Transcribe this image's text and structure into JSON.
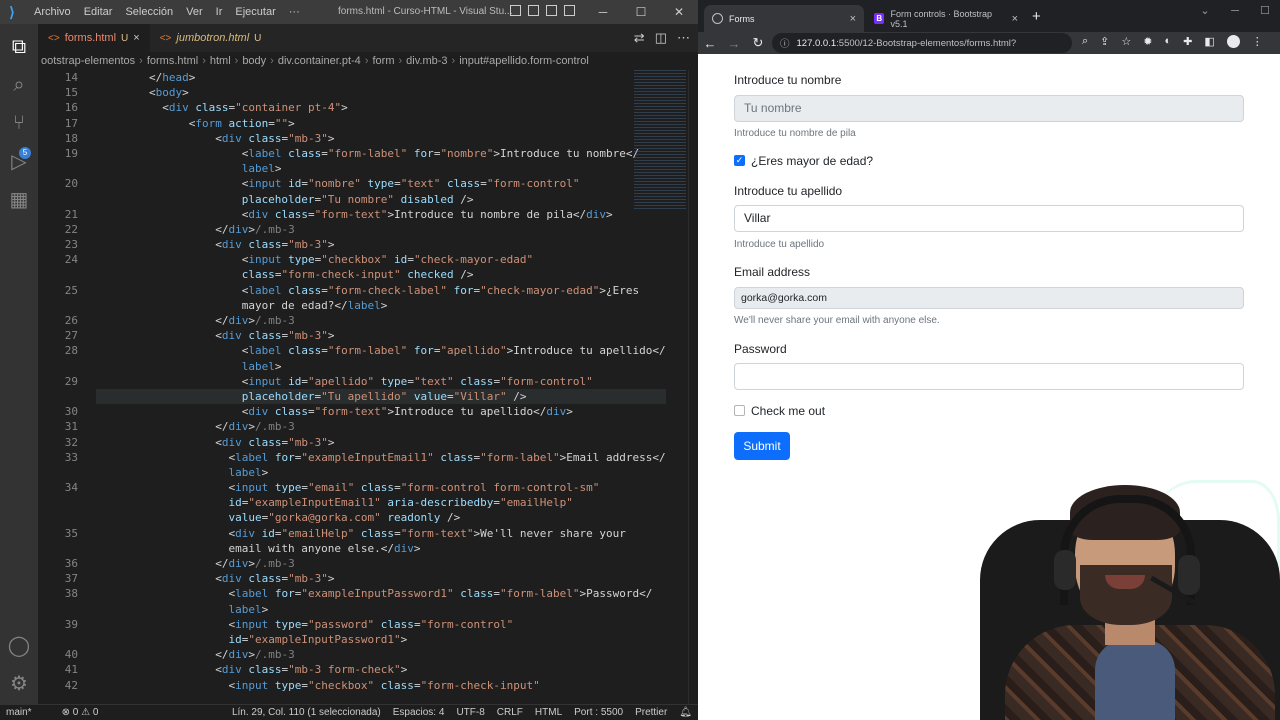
{
  "vscode": {
    "menu": [
      "Archivo",
      "Editar",
      "Selección",
      "Ver",
      "Ir",
      "Ejecutar",
      "···"
    ],
    "window_title": "forms.html - Curso-HTML - Visual Stu...",
    "tabs": [
      {
        "label": "forms.html",
        "status": "U",
        "close": "×"
      },
      {
        "label": "jumbotron.html",
        "status": "U"
      }
    ],
    "breadcrumb": [
      "ootstrap-elementos",
      "forms.html",
      "html",
      "body",
      "div.container.pt-4",
      "form",
      "div.mb-3",
      "input#apellido.form-control"
    ],
    "line_numbers": [
      "14",
      "15",
      "16",
      "17",
      "18",
      "19",
      "",
      "20",
      "",
      "21",
      "22",
      "23",
      "24",
      "",
      "25",
      "",
      "26",
      "27",
      "28",
      "",
      "29",
      "",
      "30",
      "31",
      "32",
      "33",
      "",
      "34",
      "",
      "",
      "35",
      "",
      "36",
      "37",
      "38",
      "",
      "39",
      "",
      "40",
      "41",
      "42"
    ],
    "code_lines": [
      [
        [
          "tx",
          "        </"
        ],
        [
          "tg",
          "head"
        ],
        [
          "tx",
          ">"
        ]
      ],
      [
        [
          "tx",
          "        <"
        ],
        [
          "tg",
          "body"
        ],
        [
          "tx",
          ">"
        ]
      ],
      [
        [
          "tx",
          "          <"
        ],
        [
          "tg",
          "div"
        ],
        [
          "at",
          " class"
        ],
        [
          "tx",
          "="
        ],
        [
          "vl",
          "\"container pt-4\""
        ],
        [
          "tx",
          ">"
        ]
      ],
      [
        [
          "tx",
          "              <"
        ],
        [
          "tg",
          "form"
        ],
        [
          "at",
          " action"
        ],
        [
          "tx",
          "="
        ],
        [
          "vl",
          "\"\""
        ],
        [
          "tx",
          ">"
        ]
      ],
      [
        [
          "tx",
          "                  <"
        ],
        [
          "tg",
          "div"
        ],
        [
          "at",
          " class"
        ],
        [
          "tx",
          "="
        ],
        [
          "vl",
          "\"mb-3\""
        ],
        [
          "tx",
          ">"
        ]
      ],
      [
        [
          "tx",
          "                      <"
        ],
        [
          "tg",
          "label"
        ],
        [
          "at",
          " class"
        ],
        [
          "tx",
          "="
        ],
        [
          "vl",
          "\"form-label\""
        ],
        [
          "at",
          " for"
        ],
        [
          "tx",
          "="
        ],
        [
          "vl",
          "\"nombre\""
        ],
        [
          "tx",
          ">Introduce tu nombre</"
        ]
      ],
      [
        [
          "tx",
          "                      "
        ],
        [
          "tg",
          "label"
        ],
        [
          "tx",
          ">"
        ]
      ],
      [
        [
          "tx",
          "                      <"
        ],
        [
          "tg",
          "input"
        ],
        [
          "at",
          " id"
        ],
        [
          "tx",
          "="
        ],
        [
          "vl",
          "\"nombre\""
        ],
        [
          "at",
          " type"
        ],
        [
          "tx",
          "="
        ],
        [
          "vl",
          "\"text\""
        ],
        [
          "at",
          " class"
        ],
        [
          "tx",
          "="
        ],
        [
          "vl",
          "\"form-control\""
        ]
      ],
      [
        [
          "at",
          "                      placeholder"
        ],
        [
          "tx",
          "="
        ],
        [
          "vl",
          "\"Tu nombre\""
        ],
        [
          "at",
          " disabled"
        ],
        [
          "tx",
          " />"
        ]
      ],
      [
        [
          "tx",
          "                      <"
        ],
        [
          "tg",
          "div"
        ],
        [
          "at",
          " class"
        ],
        [
          "tx",
          "="
        ],
        [
          "vl",
          "\"form-text\""
        ],
        [
          "tx",
          ">Introduce tu nombre de pila</"
        ],
        [
          "tg",
          "div"
        ],
        [
          "tx",
          ">"
        ]
      ],
      [
        [
          "tx",
          "                  </"
        ],
        [
          "tg",
          "div"
        ],
        [
          "tx",
          ">"
        ],
        [
          "cm",
          "/.mb-3"
        ]
      ],
      [
        [
          "tx",
          "                  <"
        ],
        [
          "tg",
          "div"
        ],
        [
          "at",
          " class"
        ],
        [
          "tx",
          "="
        ],
        [
          "vl",
          "\"mb-3\""
        ],
        [
          "tx",
          ">"
        ]
      ],
      [
        [
          "tx",
          "                      <"
        ],
        [
          "tg",
          "input"
        ],
        [
          "at",
          " type"
        ],
        [
          "tx",
          "="
        ],
        [
          "vl",
          "\"checkbox\""
        ],
        [
          "at",
          " id"
        ],
        [
          "tx",
          "="
        ],
        [
          "vl",
          "\"check-mayor-edad\""
        ]
      ],
      [
        [
          "at",
          "                      class"
        ],
        [
          "tx",
          "="
        ],
        [
          "vl",
          "\"form-check-input\""
        ],
        [
          "at",
          " checked"
        ],
        [
          "tx",
          " />"
        ]
      ],
      [
        [
          "tx",
          "                      <"
        ],
        [
          "tg",
          "label"
        ],
        [
          "at",
          " class"
        ],
        [
          "tx",
          "="
        ],
        [
          "vl",
          "\"form-check-label\""
        ],
        [
          "at",
          " for"
        ],
        [
          "tx",
          "="
        ],
        [
          "vl",
          "\"check-mayor-edad\""
        ],
        [
          "tx",
          ">¿Eres"
        ]
      ],
      [
        [
          "tx",
          "                      mayor de edad?</"
        ],
        [
          "tg",
          "label"
        ],
        [
          "tx",
          ">"
        ]
      ],
      [
        [
          "tx",
          "                  </"
        ],
        [
          "tg",
          "div"
        ],
        [
          "tx",
          ">"
        ],
        [
          "cm",
          "/.mb-3"
        ]
      ],
      [
        [
          "tx",
          "                  <"
        ],
        [
          "tg",
          "div"
        ],
        [
          "at",
          " class"
        ],
        [
          "tx",
          "="
        ],
        [
          "vl",
          "\"mb-3\""
        ],
        [
          "tx",
          ">"
        ]
      ],
      [
        [
          "tx",
          "                      <"
        ],
        [
          "tg",
          "label"
        ],
        [
          "at",
          " class"
        ],
        [
          "tx",
          "="
        ],
        [
          "vl",
          "\"form-label\""
        ],
        [
          "at",
          " for"
        ],
        [
          "tx",
          "="
        ],
        [
          "vl",
          "\"apellido\""
        ],
        [
          "tx",
          ">Introduce tu apellido</"
        ]
      ],
      [
        [
          "tx",
          "                      "
        ],
        [
          "tg",
          "label"
        ],
        [
          "tx",
          ">"
        ]
      ],
      [
        [
          "tx",
          "                      <"
        ],
        [
          "tg",
          "input"
        ],
        [
          "at",
          " id"
        ],
        [
          "tx",
          "="
        ],
        [
          "vl",
          "\"apellido\""
        ],
        [
          "at",
          " type"
        ],
        [
          "tx",
          "="
        ],
        [
          "vl",
          "\"text\""
        ],
        [
          "at",
          " class"
        ],
        [
          "tx",
          "="
        ],
        [
          "vl",
          "\"form-control\""
        ]
      ],
      [
        [
          "at",
          "                      placeholder"
        ],
        [
          "tx",
          "="
        ],
        [
          "vl",
          "\"Tu apellido\""
        ],
        [
          "at",
          " value"
        ],
        [
          "tx",
          "="
        ],
        [
          "vl",
          "\"Villar\""
        ],
        [
          "tx",
          " />"
        ]
      ],
      [
        [
          "tx",
          "                      <"
        ],
        [
          "tg",
          "div"
        ],
        [
          "at",
          " class"
        ],
        [
          "tx",
          "="
        ],
        [
          "vl",
          "\"form-text\""
        ],
        [
          "tx",
          ">Introduce tu apellido</"
        ],
        [
          "tg",
          "div"
        ],
        [
          "tx",
          ">"
        ]
      ],
      [
        [
          "tx",
          "                  </"
        ],
        [
          "tg",
          "div"
        ],
        [
          "tx",
          ">"
        ],
        [
          "cm",
          "/.mb-3"
        ]
      ],
      [
        [
          "tx",
          "                  <"
        ],
        [
          "tg",
          "div"
        ],
        [
          "at",
          " class"
        ],
        [
          "tx",
          "="
        ],
        [
          "vl",
          "\"mb-3\""
        ],
        [
          "tx",
          ">"
        ]
      ],
      [
        [
          "tx",
          "                    <"
        ],
        [
          "tg",
          "label"
        ],
        [
          "at",
          " for"
        ],
        [
          "tx",
          "="
        ],
        [
          "vl",
          "\"exampleInputEmail1\""
        ],
        [
          "at",
          " class"
        ],
        [
          "tx",
          "="
        ],
        [
          "vl",
          "\"form-label\""
        ],
        [
          "tx",
          ">Email address</"
        ]
      ],
      [
        [
          "tx",
          "                    "
        ],
        [
          "tg",
          "label"
        ],
        [
          "tx",
          ">"
        ]
      ],
      [
        [
          "tx",
          "                    <"
        ],
        [
          "tg",
          "input"
        ],
        [
          "at",
          " type"
        ],
        [
          "tx",
          "="
        ],
        [
          "vl",
          "\"email\""
        ],
        [
          "at",
          " class"
        ],
        [
          "tx",
          "="
        ],
        [
          "vl",
          "\"form-control form-control-sm\""
        ]
      ],
      [
        [
          "at",
          "                    id"
        ],
        [
          "tx",
          "="
        ],
        [
          "vl",
          "\"exampleInputEmail1\""
        ],
        [
          "at",
          " aria-describedby"
        ],
        [
          "tx",
          "="
        ],
        [
          "vl",
          "\"emailHelp\""
        ]
      ],
      [
        [
          "at",
          "                    value"
        ],
        [
          "tx",
          "="
        ],
        [
          "vl",
          "\"gorka@gorka.com\""
        ],
        [
          "at",
          " readonly"
        ],
        [
          "tx",
          " />"
        ]
      ],
      [
        [
          "tx",
          "                    <"
        ],
        [
          "tg",
          "div"
        ],
        [
          "at",
          " id"
        ],
        [
          "tx",
          "="
        ],
        [
          "vl",
          "\"emailHelp\""
        ],
        [
          "at",
          " class"
        ],
        [
          "tx",
          "="
        ],
        [
          "vl",
          "\"form-text\""
        ],
        [
          "tx",
          ">We'll never share your"
        ]
      ],
      [
        [
          "tx",
          "                    email with anyone else.</"
        ],
        [
          "tg",
          "div"
        ],
        [
          "tx",
          ">"
        ]
      ],
      [
        [
          "tx",
          "                  </"
        ],
        [
          "tg",
          "div"
        ],
        [
          "tx",
          ">"
        ],
        [
          "cm",
          "/.mb-3"
        ]
      ],
      [
        [
          "tx",
          "                  <"
        ],
        [
          "tg",
          "div"
        ],
        [
          "at",
          " class"
        ],
        [
          "tx",
          "="
        ],
        [
          "vl",
          "\"mb-3\""
        ],
        [
          "tx",
          ">"
        ]
      ],
      [
        [
          "tx",
          "                    <"
        ],
        [
          "tg",
          "label"
        ],
        [
          "at",
          " for"
        ],
        [
          "tx",
          "="
        ],
        [
          "vl",
          "\"exampleInputPassword1\""
        ],
        [
          "at",
          " class"
        ],
        [
          "tx",
          "="
        ],
        [
          "vl",
          "\"form-label\""
        ],
        [
          "tx",
          ">Password</"
        ]
      ],
      [
        [
          "tx",
          "                    "
        ],
        [
          "tg",
          "label"
        ],
        [
          "tx",
          ">"
        ]
      ],
      [
        [
          "tx",
          "                    <"
        ],
        [
          "tg",
          "input"
        ],
        [
          "at",
          " type"
        ],
        [
          "tx",
          "="
        ],
        [
          "vl",
          "\"password\""
        ],
        [
          "at",
          " class"
        ],
        [
          "tx",
          "="
        ],
        [
          "vl",
          "\"form-control\""
        ]
      ],
      [
        [
          "at",
          "                    id"
        ],
        [
          "tx",
          "="
        ],
        [
          "vl",
          "\"exampleInputPassword1\""
        ],
        [
          "tx",
          ">"
        ]
      ],
      [
        [
          "tx",
          "                  </"
        ],
        [
          "tg",
          "div"
        ],
        [
          "tx",
          ">"
        ],
        [
          "cm",
          "/.mb-3"
        ]
      ],
      [
        [
          "tx",
          "                  <"
        ],
        [
          "tg",
          "div"
        ],
        [
          "at",
          " class"
        ],
        [
          "tx",
          "="
        ],
        [
          "vl",
          "\"mb-3 form-check\""
        ],
        [
          "tx",
          ">"
        ]
      ],
      [
        [
          "tx",
          "                    <"
        ],
        [
          "tg",
          "input"
        ],
        [
          "at",
          " type"
        ],
        [
          "tx",
          "="
        ],
        [
          "vl",
          "\"checkbox\""
        ],
        [
          "at",
          " class"
        ],
        [
          "tx",
          "="
        ],
        [
          "vl",
          "\"form-check-input\""
        ]
      ]
    ],
    "status": {
      "branch": "main*",
      "errors": "⊗ 0 ⚠ 0",
      "position": "Lín. 29, Col. 110 (1 seleccionada)",
      "spaces": "Espacios: 4",
      "encoding": "UTF-8",
      "eol": "CRLF",
      "language": "HTML",
      "port": "Port : 5500",
      "prettier": "Prettier"
    }
  },
  "chrome": {
    "tabs": [
      {
        "title": "Forms",
        "close": "×"
      },
      {
        "title": "Form controls · Bootstrap v5.1",
        "close": "×"
      }
    ],
    "new_tab": "+",
    "url_host": "127.0.0.1",
    "url_rest": ":5500/12-Bootstrap-elementos/forms.html?",
    "favicon_b": "B"
  },
  "form": {
    "nombre_label": "Introduce tu nombre",
    "nombre_placeholder": "Tu nombre",
    "nombre_help": "Introduce tu nombre de pila",
    "mayor_label": "¿Eres mayor de edad?",
    "mayor_checked": true,
    "apellido_label": "Introduce tu apellido",
    "apellido_value": "Villar",
    "apellido_help": "Introduce tu apellido",
    "email_label": "Email address",
    "email_value": "gorka@gorka.com",
    "email_help": "We'll never share your email with anyone else.",
    "password_label": "Password",
    "checkme_label": "Check me out",
    "checkme_checked": false,
    "submit_label": "Submit"
  },
  "icons": {
    "checkmark": "✓"
  }
}
